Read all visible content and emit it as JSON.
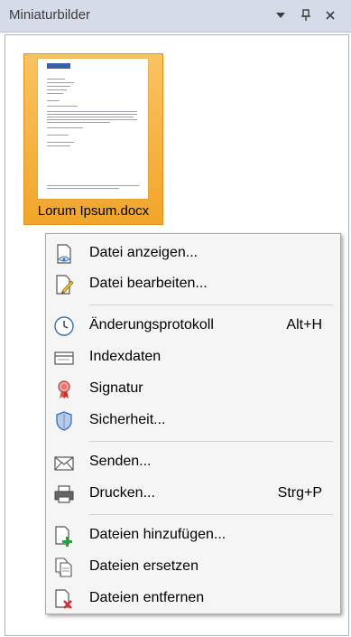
{
  "panel": {
    "title": "Miniaturbilder",
    "dropdown_icon": "triangle-down-icon",
    "pin_icon": "pin-icon",
    "close_icon": "close-icon"
  },
  "thumbnail": {
    "label": "Lorum Ipsum.docx",
    "accent": "#f5b042"
  },
  "context_menu": {
    "items": [
      {
        "label": "Datei anzeigen...",
        "icon": "view-file-icon",
        "shortcut": ""
      },
      {
        "label": "Datei bearbeiten...",
        "icon": "edit-file-icon",
        "shortcut": ""
      },
      {
        "label": "Änderungsprotokoll",
        "icon": "clock-icon",
        "shortcut": "Alt+H"
      },
      {
        "label": "Indexdaten",
        "icon": "index-card-icon",
        "shortcut": ""
      },
      {
        "label": "Signatur",
        "icon": "award-ribbon-icon",
        "shortcut": ""
      },
      {
        "label": "Sicherheit...",
        "icon": "shield-icon",
        "shortcut": ""
      },
      {
        "label": "Senden...",
        "icon": "envelope-icon",
        "shortcut": ""
      },
      {
        "label": "Drucken...",
        "icon": "printer-icon",
        "shortcut": "Strg+P"
      },
      {
        "label": "Dateien hinzufügen...",
        "icon": "add-file-icon",
        "shortcut": ""
      },
      {
        "label": "Dateien ersetzen",
        "icon": "replace-file-icon",
        "shortcut": ""
      },
      {
        "label": "Dateien entfernen",
        "icon": "remove-file-icon",
        "shortcut": ""
      }
    ]
  }
}
